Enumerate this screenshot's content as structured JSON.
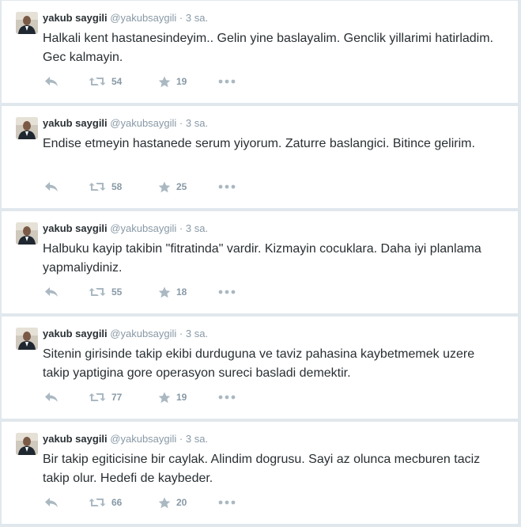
{
  "tweets": [
    {
      "fullname": "yakub saygili",
      "username": "@yakubsaygili",
      "separator": "·",
      "time": "3 sa.",
      "text": "Halkali kent hastanesindeyim.. Gelin yine baslayalim. Genclik yillarimi hatirladim. Gec kalmayin.",
      "retweets": "54",
      "favorites": "19"
    },
    {
      "fullname": "yakub saygili",
      "username": "@yakubsaygili",
      "separator": "·",
      "time": "3 sa.",
      "text": "Endise etmeyin hastanede serum yiyorum. Zaturre baslangici. Bitince gelirim.",
      "retweets": "58",
      "favorites": "25"
    },
    {
      "fullname": "yakub saygili",
      "username": "@yakubsaygili",
      "separator": "·",
      "time": "3 sa.",
      "text": "Halbuku kayip takibin  \"fitratinda\" vardir. Kizmayin cocuklara. Daha iyi planlama yapmaliydiniz.",
      "retweets": "55",
      "favorites": "18"
    },
    {
      "fullname": "yakub saygili",
      "username": "@yakubsaygili",
      "separator": "·",
      "time": "3 sa.",
      "text": "Sitenin girisinde takip ekibi durduguna ve taviz pahasina kaybetmemek uzere takip yaptigina gore operasyon sureci basladi demektir.",
      "retweets": "77",
      "favorites": "19"
    },
    {
      "fullname": "yakub saygili",
      "username": "@yakubsaygili",
      "separator": "·",
      "time": "3 sa.",
      "text": "Bir takip egiticisine bir caylak. Alindim dogrusu. Sayi az olunca mecburen taciz takip olur. Hedefi de kaybeder.",
      "retweets": "66",
      "favorites": "20"
    }
  ],
  "icons": {
    "reply": "reply-icon",
    "retweet": "retweet-icon",
    "favorite": "star-icon",
    "more": "more-dots-icon"
  },
  "colors": {
    "background": "#e1e8ed",
    "card": "#ffffff",
    "text": "#292f33",
    "muted": "#8899a6",
    "icon": "#aab8c2"
  }
}
